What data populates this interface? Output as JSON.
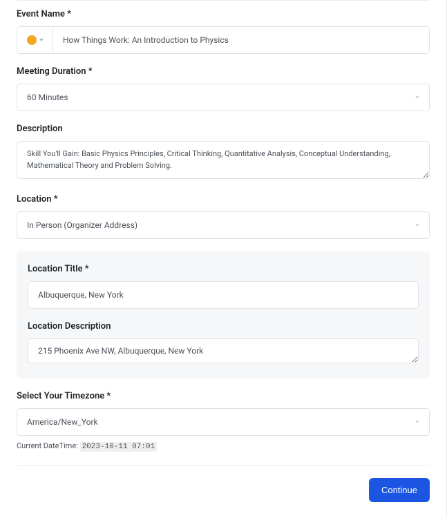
{
  "event_name": {
    "label": "Event Name *",
    "value": "How Things Work: An Introduction to Physics",
    "color": "#f5a623"
  },
  "meeting_duration": {
    "label": "Meeting Duration *",
    "value": "60 Minutes"
  },
  "description": {
    "label": "Description",
    "value": "Skill You'll Gain: Basic Physics Principles, Critical Thinking, Quantitative Analysis, Conceptual Understanding, Mathematical Theory and Problem Solving."
  },
  "location": {
    "label": "Location *",
    "value": "In Person (Organizer Address)"
  },
  "location_title": {
    "label": "Location Title *",
    "value": "Albuquerque, New York"
  },
  "location_description": {
    "label": "Location Description",
    "value": "215 Phoenix Ave NW, Albuquerque, New York"
  },
  "timezone": {
    "label": "Select Your Timezone *",
    "value": "America/New_York"
  },
  "current_datetime": {
    "label": "Current DateTime: ",
    "value": "2023-10-11 07:01"
  },
  "continue_button": "Continue"
}
